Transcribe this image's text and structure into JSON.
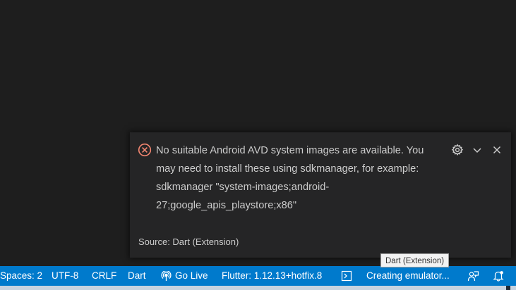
{
  "notification": {
    "message": "No suitable Android AVD system images are available. You may need to install these using sdkmanager, for example: sdkmanager \"system-images;android-27;google_apis_playstore;x86\"",
    "source": "Source: Dart (Extension)",
    "icons": {
      "severity": "error-icon",
      "settings": "gear-icon",
      "collapse": "chevron-down-icon",
      "close": "close-icon"
    },
    "colors": {
      "background": "#252526",
      "text": "#cccccc",
      "error": "#f48771"
    }
  },
  "tooltip": {
    "text": "Dart (Extension)"
  },
  "statusbar": {
    "background": "#007acc",
    "items": {
      "spaces": "Spaces: 2",
      "encoding": "UTF-8",
      "eol": "CRLF",
      "language": "Dart",
      "golive": "Go Live",
      "flutter": "Flutter: 1.12.13+hotfix.8",
      "emulator": "Creating emulator..."
    },
    "icons": {
      "golive": "broadcast-icon",
      "terminal": "terminal-icon",
      "feedback": "feedback-icon",
      "notifications": "bell-icon"
    }
  }
}
